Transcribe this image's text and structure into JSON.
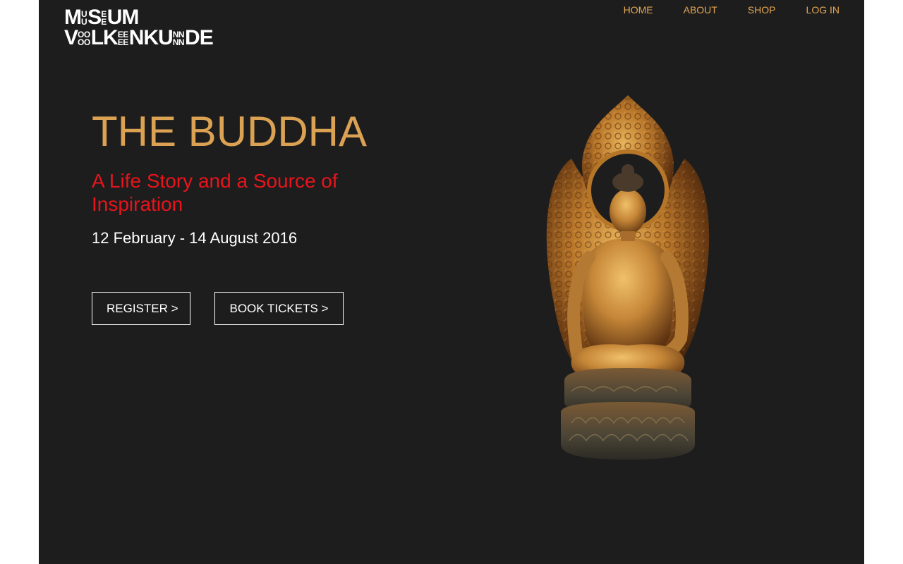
{
  "logo": {
    "line1": {
      "a": "M",
      "a_stack": [
        "U",
        "U"
      ],
      "b": "S",
      "b_stack": [
        "E",
        "E"
      ],
      "c": "UM"
    },
    "line2": {
      "a": "V",
      "a_stack": [
        "OO",
        "OO"
      ],
      "b": "LK",
      "b_stack": [
        "EE",
        "EE"
      ],
      "c": "NKU",
      "c_stack": [
        "NN",
        "NN"
      ],
      "d": "DE"
    }
  },
  "nav": {
    "items": [
      {
        "label": "HOME"
      },
      {
        "label": "ABOUT"
      },
      {
        "label": "SHOP"
      },
      {
        "label": "LOG IN"
      }
    ]
  },
  "hero": {
    "title": "THE BUDDHA",
    "subtitle": "A Life Story and a Source of Inspiration",
    "dates": "12 February - 14 August 2016",
    "register_label": "REGISTER >",
    "tickets_label": "BOOK TICKETS >"
  },
  "colors": {
    "background": "#1d1d1d",
    "nav": "#e3a652",
    "title": "#dba253",
    "subtitle": "#e8141c",
    "text": "#ffffff"
  }
}
